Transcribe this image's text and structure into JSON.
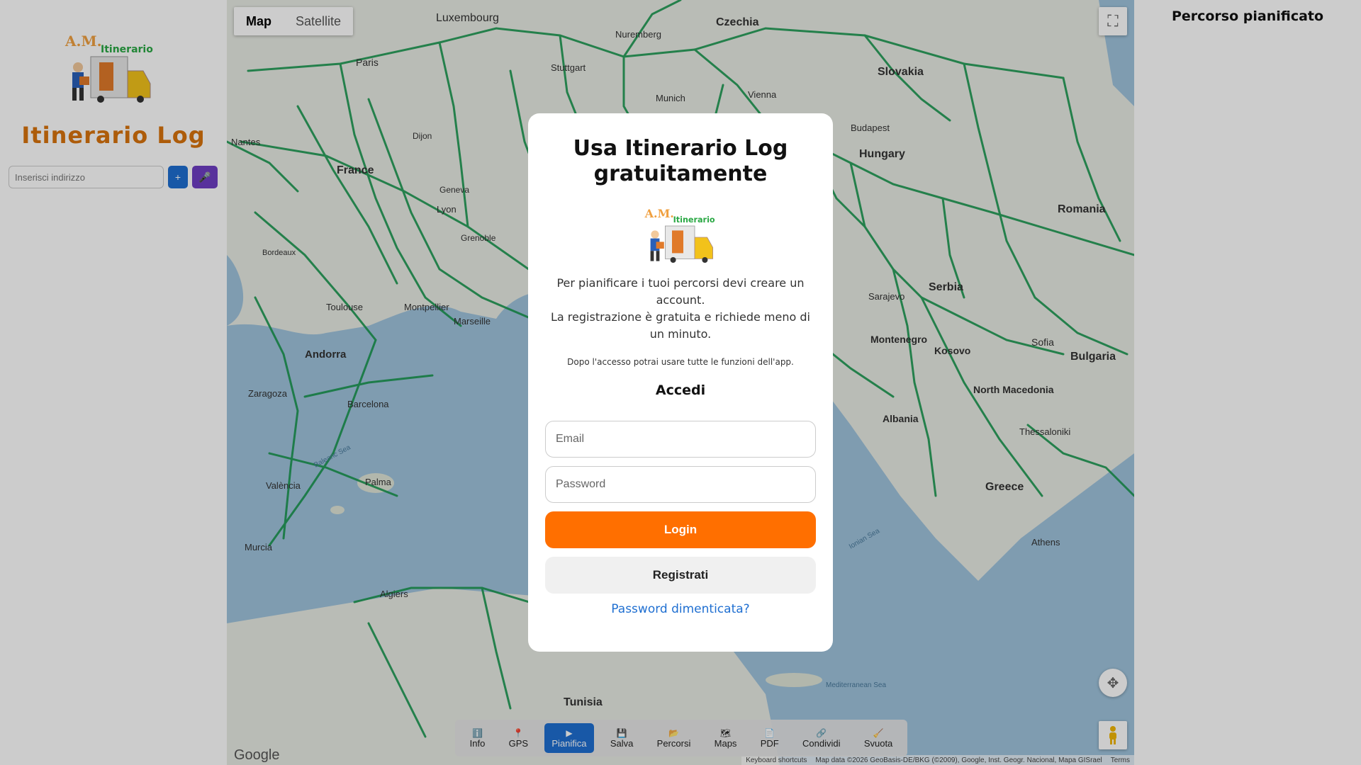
{
  "app": {
    "title": "Itinerario Log"
  },
  "search": {
    "placeholder": "Inserisci indirizzo",
    "add_label": "+",
    "mic_label": "🎤"
  },
  "map": {
    "type_map": "Map",
    "type_satellite": "Satellite",
    "google": "Google",
    "attribution": {
      "shortcuts": "Keyboard shortcuts",
      "data": "Map data ©2026 GeoBasis-DE/BKG (©2009), Google, Inst. Geogr. Nacional, Mapa GISrael",
      "terms": "Terms"
    },
    "places": [
      {
        "label": "Luxembourg"
      },
      {
        "label": "Paris"
      },
      {
        "label": "France"
      },
      {
        "label": "Nantes"
      },
      {
        "label": "Lyon"
      },
      {
        "label": "Toulouse"
      },
      {
        "label": "Marseille"
      },
      {
        "label": "Bordeaux"
      },
      {
        "label": "Andorra"
      },
      {
        "label": "Barcelona"
      },
      {
        "label": "Zaragoza"
      },
      {
        "label": "València"
      },
      {
        "label": "Palma"
      },
      {
        "label": "Murcia"
      },
      {
        "label": "Algiers"
      },
      {
        "label": "Tunisia"
      },
      {
        "label": "Czechia"
      },
      {
        "label": "Nuremberg"
      },
      {
        "label": "Stuttgart"
      },
      {
        "label": "Munich"
      },
      {
        "label": "Vienna"
      },
      {
        "label": "Slovakia"
      },
      {
        "label": "Budapest"
      },
      {
        "label": "Hungary"
      },
      {
        "label": "Romania"
      },
      {
        "label": "Serbia"
      },
      {
        "label": "Sarajevo"
      },
      {
        "label": "Montenegro"
      },
      {
        "label": "Kosovo"
      },
      {
        "label": "Albania"
      },
      {
        "label": "North Macedonia"
      },
      {
        "label": "Sofia"
      },
      {
        "label": "Bulgaria"
      },
      {
        "label": "Greece"
      },
      {
        "label": "Athens"
      },
      {
        "label": "Thessaloniki"
      },
      {
        "label": "Montpellier"
      },
      {
        "label": "Dijon"
      },
      {
        "label": "Geneva"
      },
      {
        "label": "Grenoble"
      }
    ],
    "sea_labels": {
      "balearic": "Balearic Sea",
      "ionian": "Ionian Sea",
      "med": "Mediterranean Sea"
    }
  },
  "toolbar": [
    {
      "icon": "ℹ️",
      "label": "Info",
      "active": false
    },
    {
      "icon": "📍",
      "label": "GPS",
      "active": false
    },
    {
      "icon": "▶",
      "label": "Pianifica",
      "active": true
    },
    {
      "icon": "💾",
      "label": "Salva",
      "active": false
    },
    {
      "icon": "📂",
      "label": "Percorsi",
      "active": false
    },
    {
      "icon": "🗺",
      "label": "Maps",
      "active": false
    },
    {
      "icon": "📄",
      "label": "PDF",
      "active": false
    },
    {
      "icon": "🔗",
      "label": "Condividi",
      "active": false
    },
    {
      "icon": "🧹",
      "label": "Svuota",
      "active": false
    }
  ],
  "right_panel": {
    "title": "Percorso pianificato"
  },
  "modal": {
    "title": "Usa Itinerario Log gratuitamente",
    "text_line1": "Per pianificare i tuoi percorsi devi creare un account.",
    "text_line2": "La registrazione è gratuita e richiede meno di un minuto.",
    "note": "Dopo l'accesso potrai usare tutte le funzioni dell'app.",
    "heading": "Accedi",
    "email_placeholder": "Email",
    "password_placeholder": "Password",
    "login_label": "Login",
    "register_label": "Registrati",
    "forgot_label": "Password dimenticata?"
  },
  "colors": {
    "brand_orange": "#d9730d",
    "login_orange": "#ff6f00",
    "blue": "#1f6fd1",
    "purple": "#6f3ec4",
    "road_green": "#1a9850",
    "sea": "#9fc4dd"
  }
}
